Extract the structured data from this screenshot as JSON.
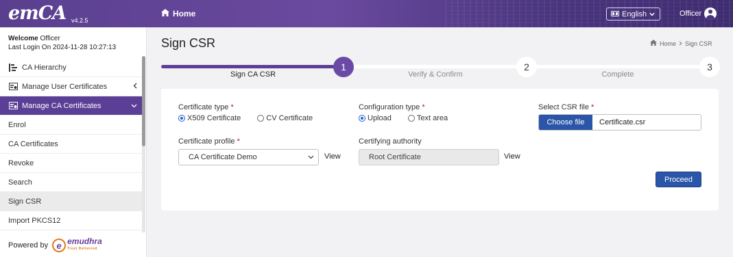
{
  "app": {
    "logo": "emCA",
    "version": "v4.2.5"
  },
  "topbar": {
    "home_label": "Home",
    "language": "English",
    "user": "Officer"
  },
  "sidebar": {
    "welcome_label": "Welcome",
    "welcome_user": "Officer",
    "last_login_label": "Last Login On",
    "last_login_value": "2024-11-28 10:27:13",
    "items": [
      {
        "label": "CA Hierarchy",
        "icon": "hierarchy-icon"
      },
      {
        "label": "Manage User Certificates",
        "icon": "certificate-icon"
      },
      {
        "label": "Manage CA Certificates",
        "icon": "certificate-icon"
      }
    ],
    "sub_items": [
      "Enrol",
      "CA Certificates",
      "Revoke",
      "Search",
      "Sign CSR",
      "Import PKCS12"
    ],
    "powered_by": "Powered by",
    "brand": "emudhra",
    "brand_tagline": "Trust Delivered"
  },
  "page": {
    "title": "Sign CSR",
    "breadcrumb": {
      "home": "Home",
      "current": "Sign CSR"
    }
  },
  "stepper": {
    "progress": 0.33,
    "steps": [
      {
        "number": "1",
        "label": "Sign CA CSR",
        "active": true
      },
      {
        "number": "2",
        "label": "Verify & Confirm",
        "active": false
      },
      {
        "number": "3",
        "label": "Complete",
        "active": false
      }
    ]
  },
  "form": {
    "certificate_type": {
      "label": "Certificate type",
      "required": "*",
      "options": [
        "X509 Certificate",
        "CV Certificate"
      ],
      "selected": "X509 Certificate"
    },
    "configuration_type": {
      "label": "Configuration type",
      "required": "*",
      "options": [
        "Upload",
        "Text area"
      ],
      "selected": "Upload"
    },
    "csr_file": {
      "label": "Select CSR file",
      "required": "*",
      "button": "Choose file",
      "file_name": "Certificate.csr"
    },
    "certificate_profile": {
      "label": "Certificate profile",
      "required": "*",
      "value": "CA Certificate Demo",
      "view": "View"
    },
    "certifying_authority": {
      "label": "Certifying authority",
      "value": "Root Certificate",
      "view": "View"
    },
    "proceed": "Proceed"
  }
}
